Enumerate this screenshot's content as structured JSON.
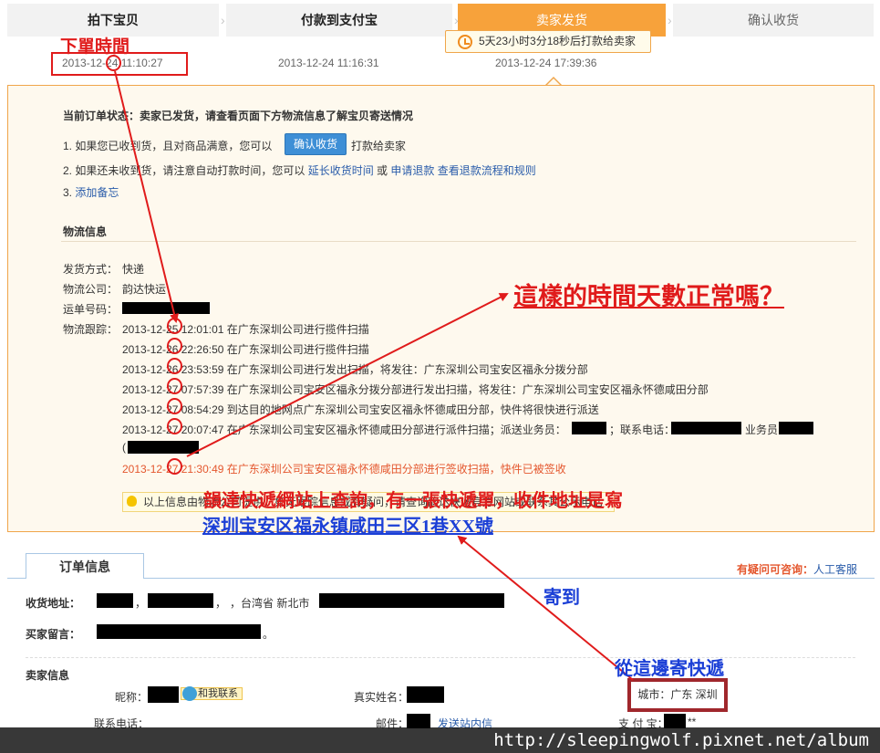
{
  "steps": [
    {
      "label": "拍下宝贝",
      "time": "2013-12-24 11:10:27"
    },
    {
      "label": "付款到支付宝",
      "time": "2013-12-24 11:16:31"
    },
    {
      "label": "卖家发货",
      "time": "2013-12-24 17:39:36"
    },
    {
      "label": "确认收货",
      "time": ""
    }
  ],
  "countdown": "5天23小时3分18秒后打款给卖家",
  "status": {
    "label": "当前订单状态：",
    "text": "卖家已发货，请查看页面下方物流信息了解宝贝寄送情况",
    "line1_prefix": "1. 如果您已收到货，且对商品满意，您可以",
    "confirm_button": "确认收货",
    "line1_suffix": "打款给卖家",
    "line2_prefix": "2. 如果还未收到货，请注意自动打款时间，您可以",
    "extend_link": "延长收货时间",
    "or": "或",
    "refund_link": "申请退款",
    "refund_flow_link": "查看退款流程和规则",
    "line3_prefix": "3.",
    "note_link": "添加备忘"
  },
  "logistics": {
    "heading": "物流信息",
    "method_label": "发货方式：",
    "method": "快递",
    "company_label": "物流公司：",
    "company": "韵达快运",
    "tracking_label": "运单号码：",
    "track_label": "物流跟踪：",
    "events": [
      "2013-12-25 12:01:01 在广东深圳公司进行揽件扫描",
      "2013-12-26 22:26:50 在广东深圳公司进行揽件扫描",
      "2013-12-26 23:53:59 在广东深圳公司进行发出扫描，将发往：广东深圳公司宝安区福永分拨分部",
      "2013-12-27 07:57:39 在广东深圳公司宝安区福永分拨分部进行发出扫描，将发往：广东深圳公司宝安区福永怀德咸田分部",
      "2013-12-27 08:54:29 到达目的地网点广东深圳公司宝安区福永怀德咸田分部，快件将很快进行派送",
      "2013-12-27 20:07:47 在广东深圳公司宝安区福永怀德咸田分部进行派件扫描；派送业务员：",
      "2013-12-27 21:30:49 在广东深圳公司宝安区福永怀德咸田分部进行签收扫描，快件已被签收"
    ],
    "event6_phone_label": "；联系电话：",
    "event6_tail": "业务员",
    "event6_paren": "(",
    "notice": "以上信息由物流公司提供，如无跟踪信息或有疑问，请查询韵达快运官方网站或联系其公示电话"
  },
  "order_info": {
    "tab": "订单信息",
    "help_label": "有疑问可咨询：",
    "help_link": "人工客服",
    "address_label": "收货地址：",
    "address_sep1": "，",
    "address_sep2": "，",
    "address_region": "，台湾省 新北市",
    "message_label": "买家留言：",
    "message_tail": "。",
    "seller_heading": "卖家信息",
    "nickname_label": "昵称：",
    "contact_button": "和我联系",
    "realname_label": "真实姓名：",
    "city": "城市：广东 深圳",
    "phone_label": "联系电话：",
    "email_label": "邮件：",
    "email_link": "发送站内信",
    "alipay_label": "支 付 宝：",
    "alipay_tail": "**"
  },
  "annotations": {
    "order_time": "下單時間",
    "question": "這樣的時間天數正常嗎？",
    "search_result": "韻達快遞網站上查詢，有一張快遞單，收件地址是寫",
    "address": "深圳宝安区福永镇咸田三区1巷XX號",
    "sent_to": "寄到",
    "sent_from": "從這邊寄快遞"
  },
  "watermark": "http://sleepingwolf.pixnet.net/album",
  "colors": {
    "accent_orange": "#f7a23b",
    "annotation_red": "#e01b1b",
    "annotation_blue": "#1b3fd6",
    "link_blue": "#2a5caa"
  }
}
